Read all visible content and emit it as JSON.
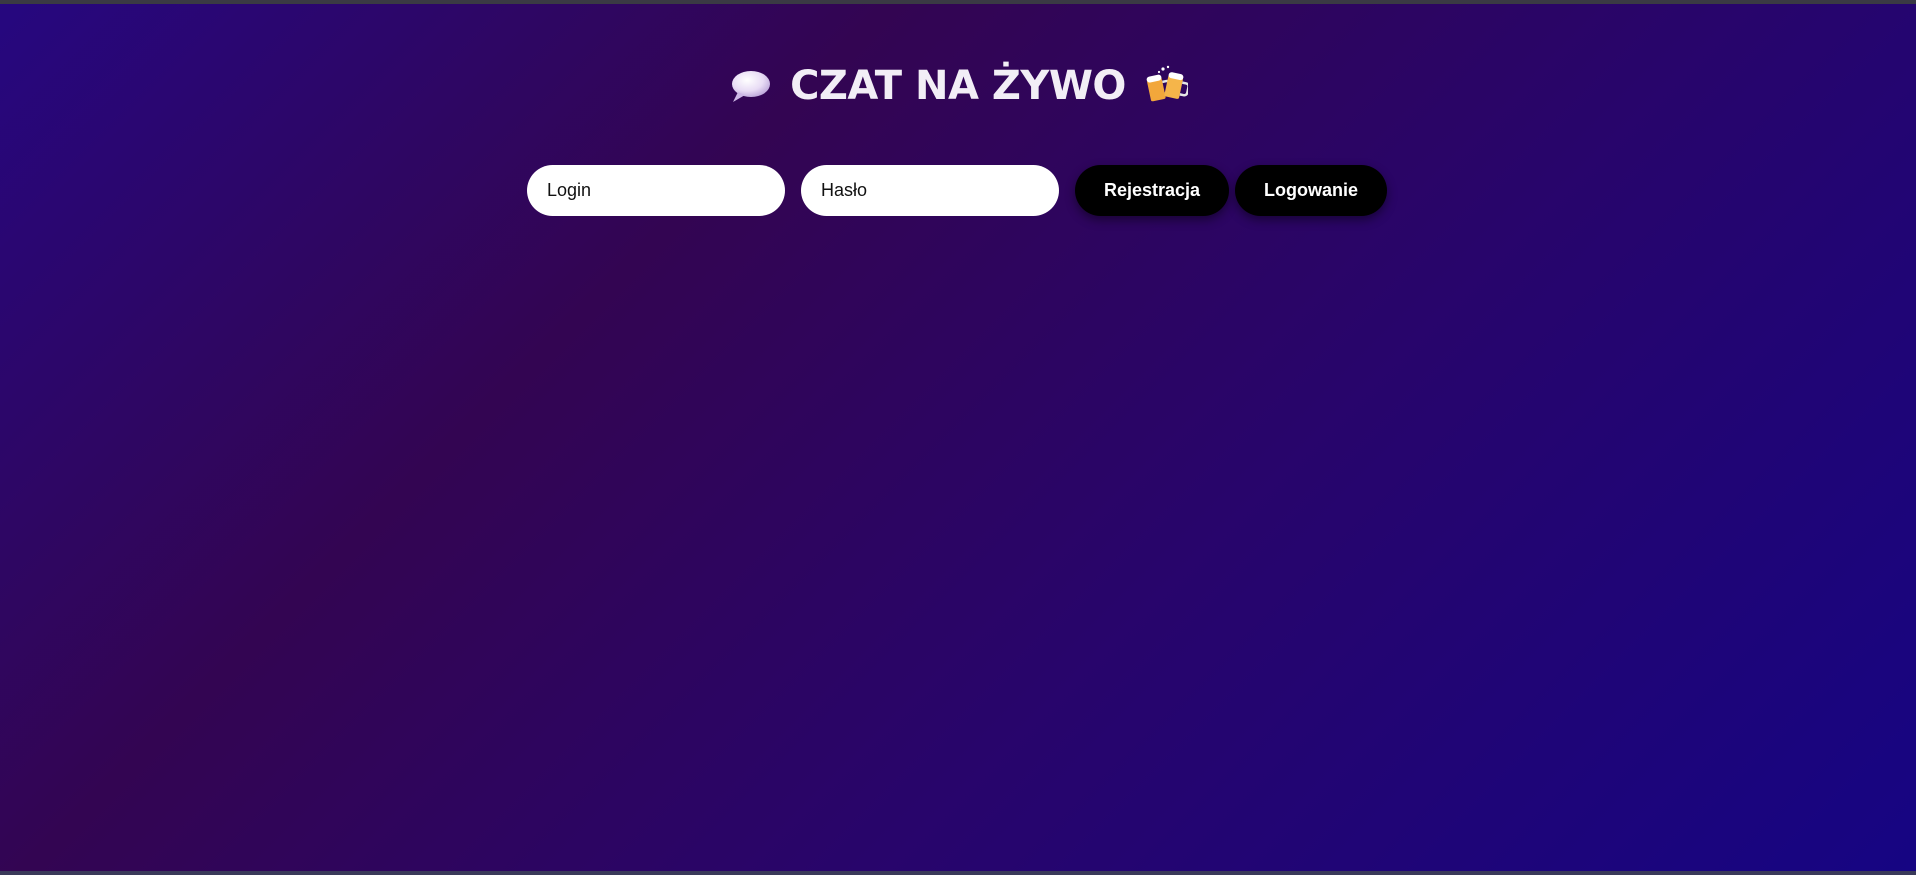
{
  "header": {
    "title": "CZAT NA ŻYWO",
    "left_icon": "speech-bubble-icon",
    "right_icon": "clinking-beer-mugs-icon"
  },
  "auth_form": {
    "login_placeholder": "Login",
    "password_placeholder": "Hasło",
    "register_label": "Rejestracja",
    "login_label": "Logowanie"
  },
  "colors": {
    "background_start": "#26077f",
    "background_mid": "#330552",
    "background_end": "#160583",
    "title": "#f2eef6",
    "button_bg": "#000000",
    "button_text": "#ffffff",
    "input_bg": "#ffffff"
  }
}
